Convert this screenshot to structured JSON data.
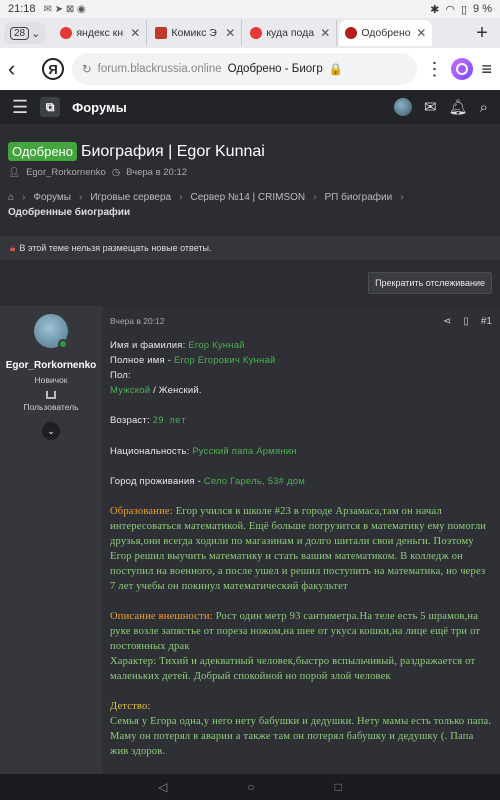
{
  "status": {
    "time": "21:18",
    "battery": "9 %"
  },
  "tabs": {
    "count": "28",
    "items": [
      {
        "label": "яндекс кн",
        "color": "#e53935"
      },
      {
        "label": "Комикс Э",
        "color": "#c0392b"
      },
      {
        "label": "куда пода",
        "color": "#e53935"
      },
      {
        "label": "Одобрено",
        "color": "#b71c1c"
      }
    ]
  },
  "browser": {
    "domain": "forum.blackrussia.online",
    "path": "Одобрено - Биогр",
    "yandex": "Я"
  },
  "forum": {
    "title": "Форумы"
  },
  "thread": {
    "badge": "Одобрено",
    "title": "Биография | Egor Kunnai",
    "author": "Egor_Rorkornenko",
    "date": "Вчера в 20:12"
  },
  "breadcrumbs": [
    "Форумы",
    "Игровые сервера",
    "Сервер №14 | CRIMSON",
    "РП биографии"
  ],
  "breadcrumb_last": "Одобренные биографии",
  "locked_notice": "В этой теме нельзя размещать новые ответы.",
  "watch_button": "Прекратить отслеживание",
  "post": {
    "author": "Egor_Rorkornenko",
    "user_title": "Новичок",
    "role": "Пользователь",
    "date": "Вчера в 20:12",
    "number": "#1",
    "lines": {
      "l1a": "Имя и фамилия",
      "l1b": "Егор Куннай",
      "l2a": "Полное имя",
      "l2b": "Егор Егорович Куннай",
      "l3": "Пол",
      "l4a": "Мужской",
      "l4b": "Женский",
      "l5a": "Возраст",
      "l5b": "29 лет",
      "l6a": "Национальность",
      "l6b": "Русский папа Армянин",
      "l7a": "Город проживания",
      "l7b": "Село Гарель, 53# дом",
      "edu_label": "Образование",
      "edu_text": "Егор учился в школе #23 в городе Арзамаса,там он начал интересоваться математикой. Ещё больше погрузится в математику ему помогли друзья,они всегда ходили по магазинам и долго шитали свои деньги. Поэтому Егор решил выучить математику и стать вашим математиком. В колледж он поступил на военного, а после ушел и решил поступить на математика, но через 7 лет учебы он покинул математический факультет",
      "look_label": "Описание внешности",
      "look_text": "Рост один метр 93 сантиметра.На теле есть 5 шрамов,на руке возле запястье от пореза ножом,на шее от укуса кошки,на лице ещё три от постоянных драк",
      "char_text": "Характер: Тихий и адекватный человек,быстро вспыльчивый, раздражается от маленьких детей. Добрый спокойной но порой злой человек",
      "child_label": "Детство",
      "child_text": "Семья у Егора одна,у него нету бабушки и дедушки. Нету мамы есть только папа. Маму он потерял в аварии а также там он потерял бабушку и дедушку (. Папа жив здоров."
    }
  }
}
